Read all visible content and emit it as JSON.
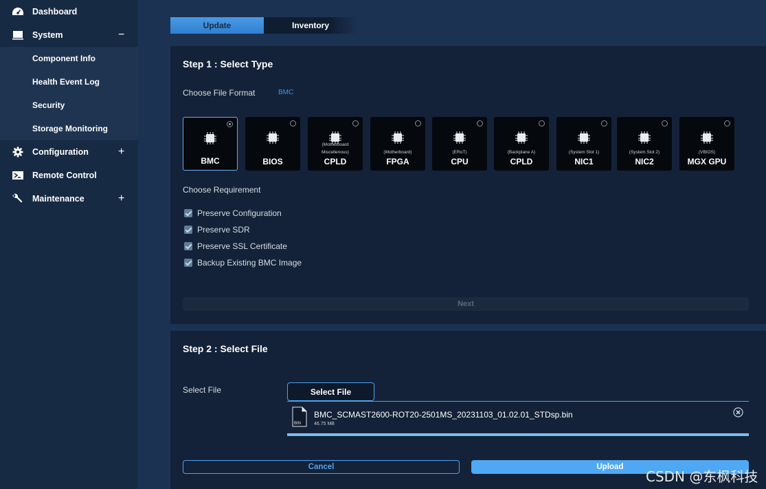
{
  "sidebar": {
    "items": [
      {
        "label": "Dashboard",
        "icon": "dashboard-icon"
      },
      {
        "label": "System",
        "icon": "monitor-icon",
        "toggle": "−"
      },
      {
        "label": "Configuration",
        "icon": "gear-icon",
        "toggle": "+"
      },
      {
        "label": "Remote Control",
        "icon": "terminal-icon"
      },
      {
        "label": "Maintenance",
        "icon": "wrench-icon",
        "toggle": "+"
      }
    ],
    "sub_items": [
      "Component Info",
      "Health Event Log",
      "Security",
      "Storage Monitoring"
    ]
  },
  "tabs": [
    {
      "label": "Update",
      "active": true
    },
    {
      "label": "Inventory",
      "active": false
    }
  ],
  "step1": {
    "title": "Step 1 : Select Type",
    "file_format_label": "Choose File Format",
    "file_format_value": "BMC",
    "cards": [
      {
        "name": "BMC",
        "sub": "",
        "sub2": "",
        "selected": true
      },
      {
        "name": "BIOS",
        "sub": "",
        "sub2": "",
        "selected": false
      },
      {
        "name": "CPLD",
        "sub": "Miscellenous)",
        "sub2": "(Motherboard",
        "selected": false
      },
      {
        "name": "FPGA",
        "sub": "(Motherboard)",
        "sub2": "",
        "selected": false
      },
      {
        "name": "CPU",
        "sub": "(ERoT)",
        "sub2": "",
        "selected": false
      },
      {
        "name": "CPLD",
        "sub": "(Backplane A)",
        "sub2": "",
        "selected": false
      },
      {
        "name": "NIC1",
        "sub": "(System Slot 1)",
        "sub2": "",
        "selected": false
      },
      {
        "name": "NIC2",
        "sub": "(System Slot 2)",
        "sub2": "",
        "selected": false
      },
      {
        "name": "MGX GPU",
        "sub": "(VBIOS)",
        "sub2": "",
        "selected": false
      }
    ],
    "requirement_label": "Choose Requirement",
    "requirements": [
      {
        "label": "Preserve Configuration",
        "checked": true
      },
      {
        "label": "Preserve SDR",
        "checked": true
      },
      {
        "label": "Preserve SSL Certificate",
        "checked": true
      },
      {
        "label": "Backup Existing BMC Image",
        "checked": true
      }
    ],
    "next_label": "Next"
  },
  "step2": {
    "title": "Step 2 : Select File",
    "select_label": "Select File",
    "select_button": "Select File",
    "file_name": "BMC_SCMAST2600-ROT20-2501MS_20231103_01.02.01_STDsp.bin",
    "file_size": "46.75 MB",
    "file_type": "BIN",
    "cancel_label": "Cancel",
    "upload_label": "Upload"
  },
  "watermark": "CSDN @东枫科技",
  "colors": {
    "accent": "#4fa3f0",
    "sidebar": "#172a44",
    "background": "#1c3252",
    "panel": "#132238"
  }
}
